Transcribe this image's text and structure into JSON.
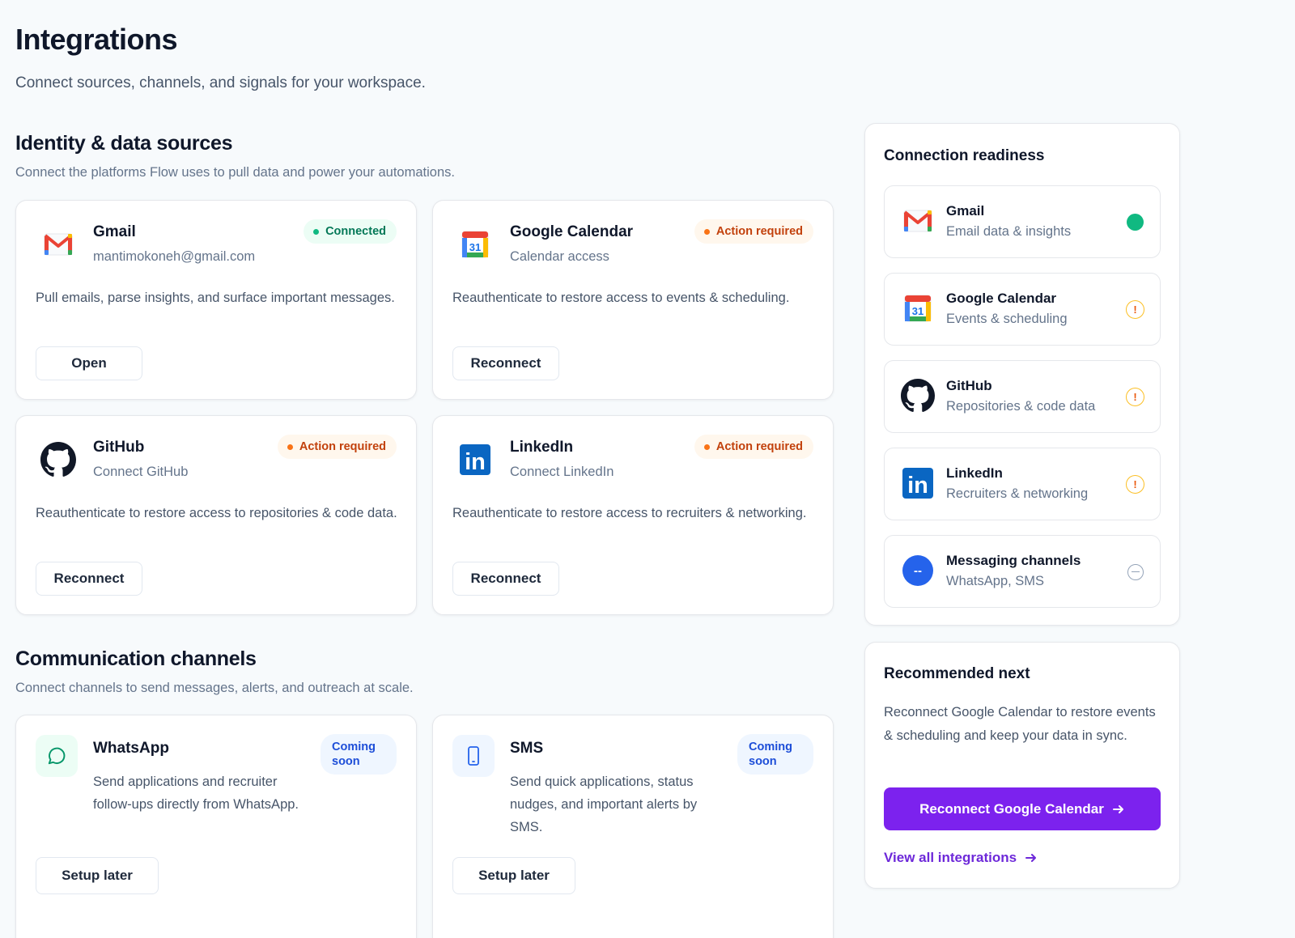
{
  "page": {
    "title": "Integrations",
    "subtitle": "Connect sources, channels, and signals for your workspace."
  },
  "identity": {
    "title": "Identity & data sources",
    "subtitle": "Connect the platforms Flow uses to pull data and power your automations.",
    "cards": [
      {
        "icon": "gmail-icon",
        "name": "Gmail",
        "detail": "mantimokoneh@gmail.com",
        "status": "Connected",
        "description": "Pull emails, parse insights, and surface important messages.",
        "action": "Open"
      },
      {
        "icon": "google-calendar-icon",
        "name": "Google Calendar",
        "detail": "Calendar access",
        "status": "Action required",
        "description": "Reauthenticate to restore access to events & scheduling.",
        "action": "Reconnect",
        "calendar_day": "31"
      },
      {
        "icon": "github-icon",
        "name": "GitHub",
        "detail": "Connect GitHub",
        "status": "Action required",
        "description": "Reauthenticate to restore access to repositories & code data.",
        "action": "Reconnect"
      },
      {
        "icon": "linkedin-icon",
        "name": "LinkedIn",
        "detail": "Connect LinkedIn",
        "status": "Action required",
        "description": "Reauthenticate to restore access to recruiters & networking.",
        "action": "Reconnect",
        "logo_text": "in"
      }
    ]
  },
  "communication": {
    "title": "Communication channels",
    "subtitle": "Connect channels to send messages, alerts, and outreach at scale.",
    "cards": [
      {
        "icon": "whatsapp-chat-icon",
        "name": "WhatsApp",
        "status": "Coming soon",
        "description": "Send applications and recruiter follow-ups directly from WhatsApp.",
        "action": "Setup later"
      },
      {
        "icon": "sms-phone-icon",
        "name": "SMS",
        "status": "Coming soon",
        "description": "Send quick applications, status nudges, and important alerts by SMS.",
        "action": "Setup later"
      }
    ]
  },
  "readiness": {
    "title": "Connection readiness",
    "items": [
      {
        "icon": "gmail-icon",
        "name": "Gmail",
        "detail": "Email data & insights",
        "state": "connected"
      },
      {
        "icon": "google-calendar-icon",
        "name": "Google Calendar",
        "detail": "Events & scheduling",
        "state": "warning",
        "calendar_day": "31"
      },
      {
        "icon": "github-icon",
        "name": "GitHub",
        "detail": "Repositories & code data",
        "state": "warning"
      },
      {
        "icon": "linkedin-icon",
        "name": "LinkedIn",
        "detail": "Recruiters & networking",
        "state": "warning",
        "logo_text": "in"
      },
      {
        "icon": "messaging-icon",
        "name": "Messaging channels",
        "detail": "WhatsApp, SMS",
        "state": "unavailable",
        "logo_text": "--"
      }
    ],
    "warning_mark": "!"
  },
  "recommended": {
    "title": "Recommended next",
    "text": "Reconnect Google Calendar to restore events & scheduling and keep your data in sync.",
    "button": "Reconnect Google Calendar",
    "link": "View all integrations"
  },
  "colors": {
    "accent": "#7c22ee",
    "connected": "#10b981",
    "warning": "#f97316",
    "info": "#1d4ed8"
  }
}
